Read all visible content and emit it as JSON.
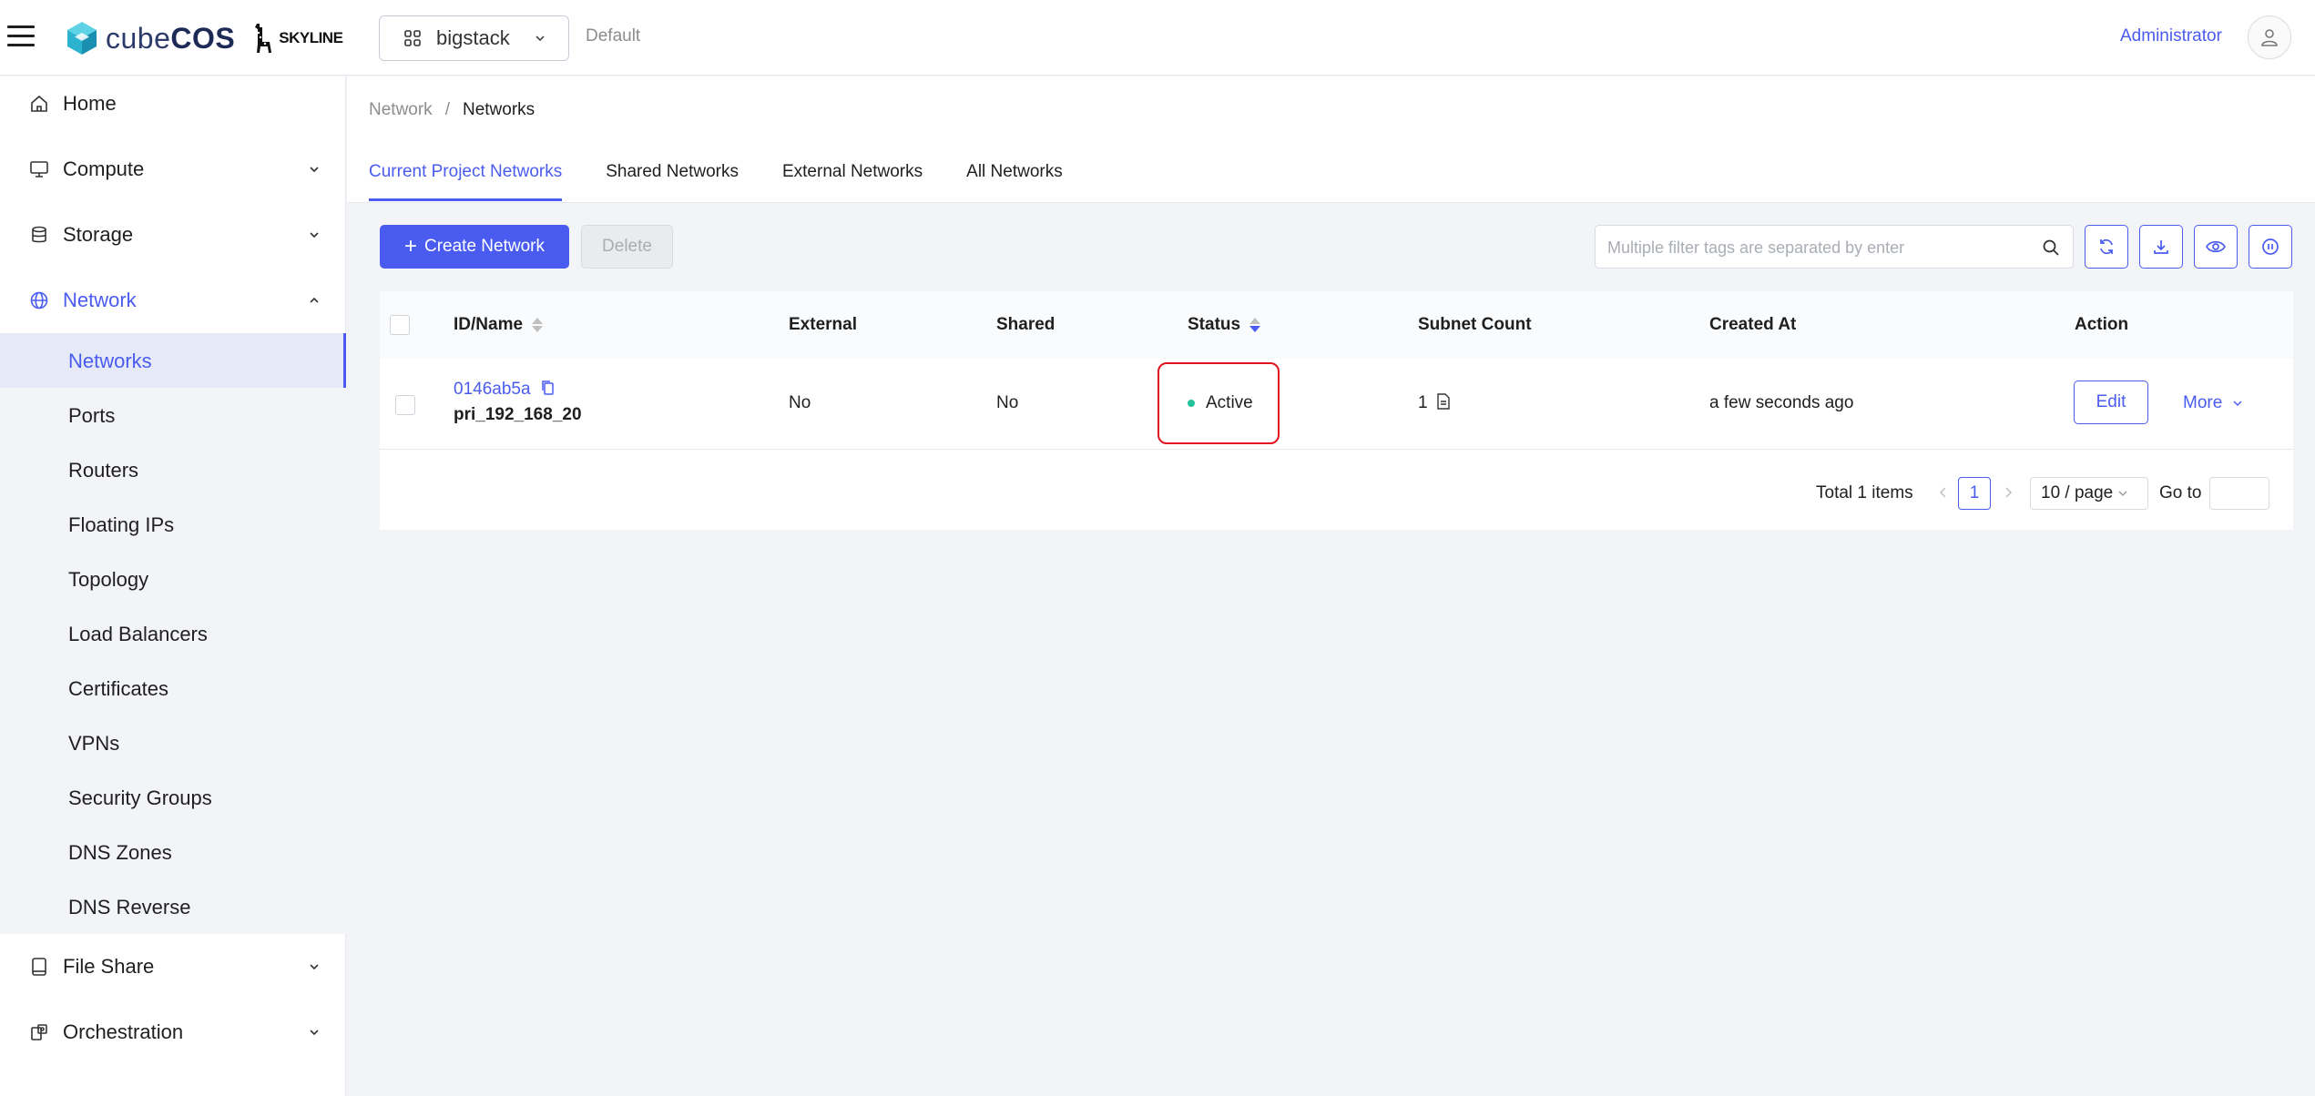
{
  "app": {
    "brand": "cubeCOS",
    "brand_light": "cube",
    "brand_bold": "COS",
    "partner": "SKYLINE"
  },
  "topbar": {
    "project": "bigstack",
    "domain": "Default",
    "user": "Administrator"
  },
  "sidebar": {
    "items": [
      {
        "label": "Home",
        "icon": "home-icon"
      },
      {
        "label": "Compute",
        "icon": "monitor-icon"
      },
      {
        "label": "Storage",
        "icon": "database-icon"
      },
      {
        "label": "Network",
        "icon": "globe-icon"
      },
      {
        "label": "File Share",
        "icon": "file-icon"
      },
      {
        "label": "Orchestration",
        "icon": "orchestration-icon"
      }
    ],
    "network_sub": [
      "Networks",
      "Ports",
      "Routers",
      "Floating IPs",
      "Topology",
      "Load Balancers",
      "Certificates",
      "VPNs",
      "Security Groups",
      "DNS Zones",
      "DNS Reverse"
    ]
  },
  "breadcrumb": {
    "parent": "Network",
    "separator": "/",
    "current": "Networks"
  },
  "tabs": [
    "Current Project Networks",
    "Shared Networks",
    "External Networks",
    "All Networks"
  ],
  "toolbar": {
    "create_label": "Create Network",
    "delete_label": "Delete",
    "search_placeholder": "Multiple filter tags are separated by enter"
  },
  "table": {
    "columns": [
      "ID/Name",
      "External",
      "Shared",
      "Status",
      "Subnet Count",
      "Created At",
      "Action"
    ],
    "rows": [
      {
        "id": "0146ab5a",
        "name": "pri_192_168_20",
        "external": "No",
        "shared": "No",
        "status": "Active",
        "subnet_count": "1",
        "created_at": "a few seconds ago",
        "edit_label": "Edit",
        "more_label": "More"
      }
    ]
  },
  "pagination": {
    "total": "Total 1 items",
    "page": "1",
    "page_size": "10 / page",
    "goto": "Go to"
  },
  "colors": {
    "accent": "#4a5cf0",
    "status_active": "#22c39a",
    "highlight": "#e0141e"
  }
}
